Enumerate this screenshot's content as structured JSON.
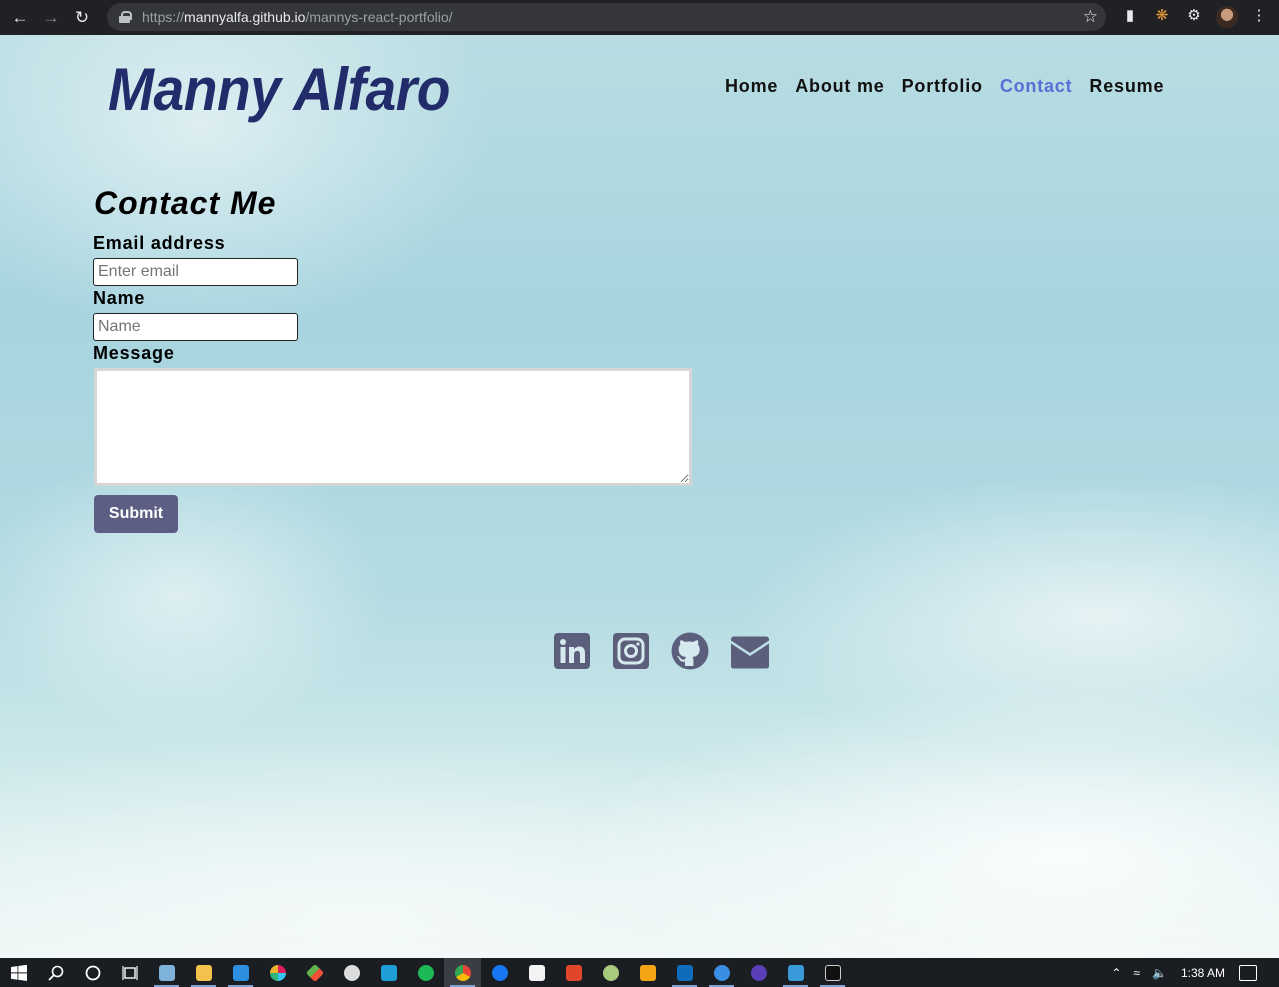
{
  "browser": {
    "url_scheme": "https://",
    "url_host": "mannyalfa.github.io",
    "url_path": "/mannys-react-portfolio/"
  },
  "site": {
    "logo": "Manny Alfaro",
    "nav": [
      {
        "label": "Home",
        "active": false
      },
      {
        "label": "About me",
        "active": false
      },
      {
        "label": "Portfolio",
        "active": false
      },
      {
        "label": "Contact",
        "active": true
      },
      {
        "label": "Resume",
        "active": false
      }
    ],
    "active_color": "#5a6fd6",
    "logo_color": "#232c6b"
  },
  "contact_form": {
    "title": "Contact Me",
    "email_label": "Email address",
    "email_placeholder": "Enter email",
    "name_label": "Name",
    "name_placeholder": "Name",
    "message_label": "Message",
    "submit_label": "Submit",
    "submit_color": "#5c5f83"
  },
  "socials": [
    "linkedin-icon",
    "instagram-icon",
    "github-icon",
    "envelope-icon"
  ],
  "taskbar": {
    "clock": "1:38 AM",
    "apps": [
      "notepad",
      "file-explorer",
      "vscode",
      "slack",
      "git",
      "github-desktop",
      "kite",
      "spotify",
      "chrome",
      "facebook",
      "store",
      "office",
      "paint",
      "media-player",
      "outlook",
      "firefox",
      "tor",
      "photos",
      "terminal"
    ]
  }
}
